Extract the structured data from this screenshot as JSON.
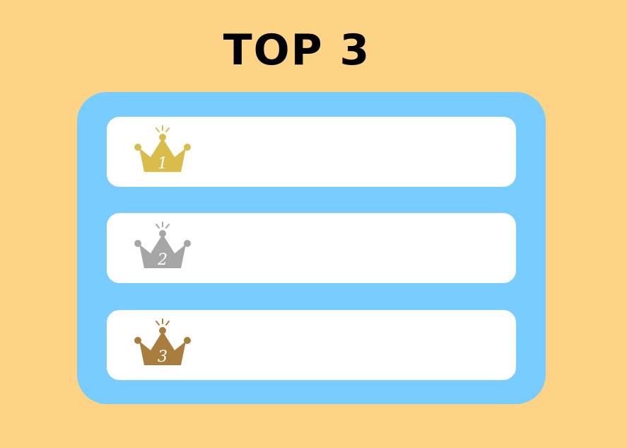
{
  "title": "TOP 3",
  "colors": {
    "background": "#FDD385",
    "panel": "#79CDFE",
    "row": "#FFFFFF",
    "gold": "#D9BC4C",
    "silver": "#A6A6A6",
    "bronze": "#A87D3E"
  },
  "ranks": [
    {
      "number": "1",
      "icon": "gold-crown-icon",
      "color": "#D9BC4C",
      "text": ""
    },
    {
      "number": "2",
      "icon": "silver-crown-icon",
      "color": "#A6A6A6",
      "text": ""
    },
    {
      "number": "3",
      "icon": "bronze-crown-icon",
      "color": "#A87D3E",
      "text": ""
    }
  ]
}
